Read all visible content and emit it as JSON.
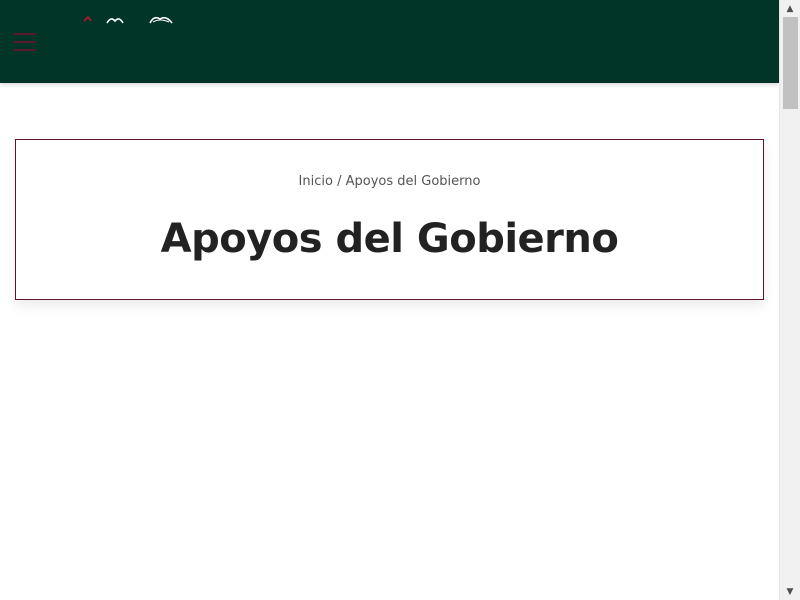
{
  "header": {
    "menu_icon": "hamburger-menu-icon",
    "logo_icon": "government-logo-icon",
    "background_color": "#003527"
  },
  "breadcrumb": {
    "home_label": "Inicio",
    "separator": " / ",
    "current_label": "Apoyos del Gobierno"
  },
  "page": {
    "title": "Apoyos del Gobierno",
    "accent_color": "#611232"
  },
  "scrollbar": {
    "up_icon": "scroll-up-arrow-icon",
    "down_icon": "scroll-down-arrow-icon"
  }
}
